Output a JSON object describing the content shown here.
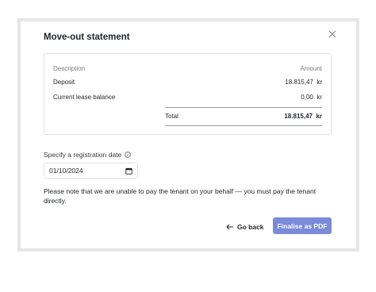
{
  "modal": {
    "title": "Move-out statement"
  },
  "statement": {
    "header": {
      "description": "Description",
      "amount": "Amount"
    },
    "rows": [
      {
        "label": "Deposit",
        "amount": "18.815,47",
        "currency": "kr"
      },
      {
        "label": "Current lease balance",
        "amount": "0,00",
        "currency": "kr"
      }
    ],
    "total": {
      "label": "Total",
      "amount": "18.815,47",
      "currency": "kr"
    }
  },
  "registration": {
    "label": "Specify a registration date",
    "date_value": "01/10/2024"
  },
  "note": "Please note that we are unable to pay the tenant on your behalf — you must pay the tenant directly.",
  "actions": {
    "back_label": "Go back",
    "finalise_label": "Finalise as PDF"
  },
  "colors": {
    "primary": "#7b8ad9",
    "frame": "#e6e6e6"
  }
}
